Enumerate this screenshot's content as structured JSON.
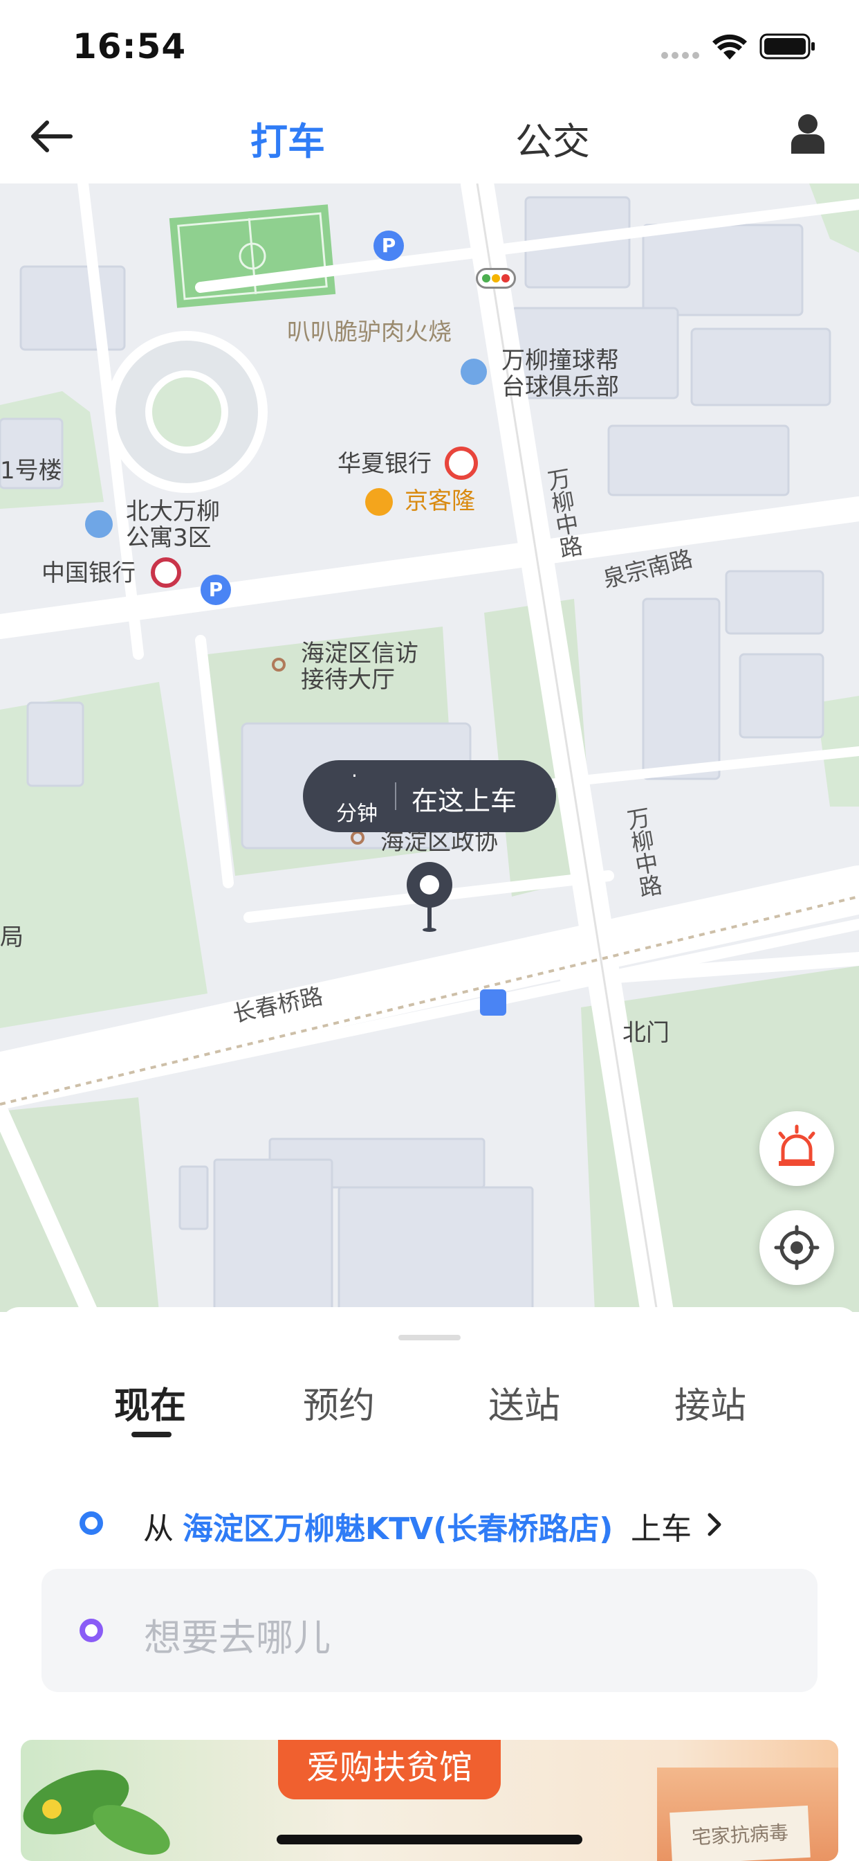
{
  "status_bar": {
    "time": "16:54"
  },
  "nav": {
    "tab_taxi": "打车",
    "tab_bus": "公交"
  },
  "map": {
    "pois": {
      "bbq": "叭叭脆驴肉火烧",
      "billiards_1": "万柳撞球帮",
      "billiards_2": "台球俱乐部",
      "hxbank": "华夏银行",
      "jingkelong": "京客隆",
      "building1": "1号楼",
      "apt_1": "北大万柳",
      "apt_2": "公寓3区",
      "boc": "中国银行",
      "xinfang_1": "海淀区信访",
      "xinfang_2": "接待大厅",
      "zhengxie": "海淀区政协",
      "ju": "局",
      "beimen": "北门"
    },
    "roads": {
      "wanliu_north": "万柳中路",
      "quanzong": "泉宗南路",
      "wanliu_south": "万柳中路",
      "changchun": "长春桥路"
    },
    "pickup": {
      "minutes_dot": "·",
      "minutes_label": "分钟",
      "action": "在这上车"
    }
  },
  "panel": {
    "tabs": [
      "现在",
      "预约",
      "送站",
      "接站"
    ],
    "pickup_prefix": "从",
    "pickup_place": "海淀区万柳魅KTV(长春桥路店)",
    "pickup_suffix": "上车",
    "destination_placeholder": "想要去哪儿"
  },
  "banner": {
    "title": "爱购扶贫馆",
    "box_text": "宅家抗病毒"
  },
  "colors": {
    "accent": "#2f7cf6",
    "dest_dot": "#8a5cf6",
    "tooltip_bg": "#3e4350",
    "alarm": "#f04a32",
    "banner_title_bg": "#f0602f"
  }
}
